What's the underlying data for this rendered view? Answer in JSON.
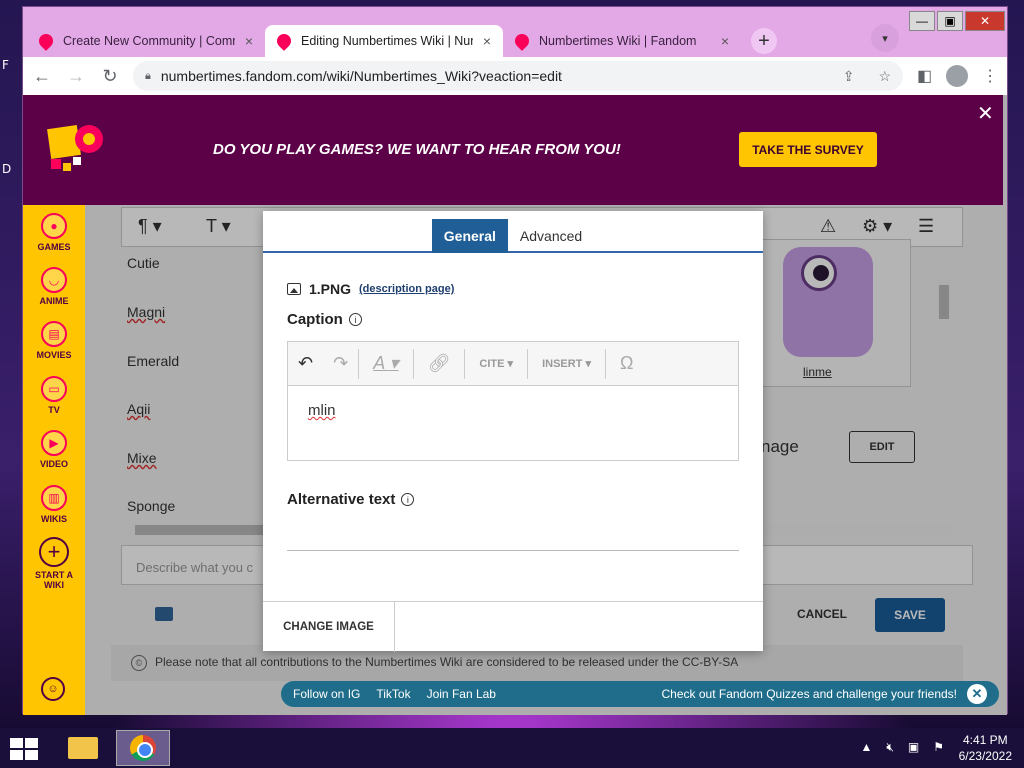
{
  "desktop": {
    "label1": "F",
    "label2": "D"
  },
  "browser": {
    "tabs": [
      {
        "title": "Create New Community | Comm",
        "close": "×",
        "active": false
      },
      {
        "title": "Editing Numbertimes Wiki | Num",
        "close": "×",
        "active": true
      },
      {
        "title": "Numbertimes Wiki | Fandom",
        "close": "×",
        "active": false
      }
    ],
    "new_tab": "+",
    "url": "numbertimes.fandom.com/wiki/Numbertimes_Wiki?veaction=edit",
    "nav": {
      "back": "←",
      "forward": "→",
      "reload": "↻"
    }
  },
  "survey_banner": {
    "text": "DO YOU PLAY GAMES? WE WANT TO HEAR FROM YOU!",
    "button": "TAKE THE SURVEY",
    "close": "✕"
  },
  "global_nav": {
    "items": [
      {
        "label": "GAMES",
        "icon": "gamepad-icon"
      },
      {
        "label": "ANIME",
        "icon": "anime-icon"
      },
      {
        "label": "MOVIES",
        "icon": "clapper-icon"
      },
      {
        "label": "TV",
        "icon": "tv-icon"
      },
      {
        "label": "VIDEO",
        "icon": "video-icon"
      },
      {
        "label": "WIKIS",
        "icon": "book-icon"
      }
    ],
    "start_wiki_line1": "START A",
    "start_wiki_line2": "WIKI"
  },
  "editor_bg": {
    "names": [
      "Cutie",
      "Magni",
      "Emerald",
      "Aqii",
      "Mixe",
      "Sponge"
    ],
    "image_caption": "linme",
    "image_label_fragment": "nage",
    "edit_button": "EDIT",
    "summary_placeholder": "Describe what you c",
    "cancel": "CANCEL",
    "save": "SAVE",
    "license": "Please note that all contributions to the Numbertimes Wiki are considered to be released under the CC-BY-SA"
  },
  "fan_bar": {
    "links": [
      "Follow on IG",
      "TikTok",
      "Join Fan Lab"
    ],
    "promo": "Check out Fandom Quizzes and challenge your friends!"
  },
  "dialog": {
    "tabs": [
      "General",
      "Advanced"
    ],
    "active_tab": "General",
    "file_name": "1.PNG",
    "description_link": "(description page)",
    "caption_label": "Caption",
    "caption_toolbar": {
      "cite": "CITE",
      "insert": "INSERT",
      "special": "Ω"
    },
    "caption_text": "mlin",
    "alt_label": "Alternative text",
    "change_image": "CHANGE IMAGE"
  },
  "taskbar": {
    "time": "4:41 PM",
    "date": "6/23/2022"
  }
}
